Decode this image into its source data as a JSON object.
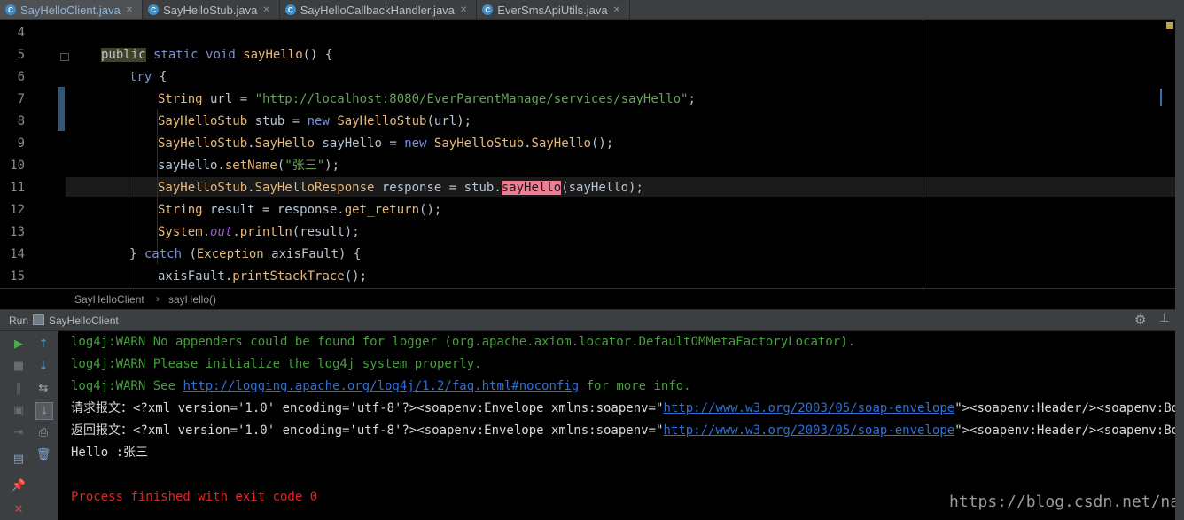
{
  "tabs": [
    {
      "label": "SayHelloClient.java",
      "icon": "C",
      "active": true
    },
    {
      "label": "SayHelloStub.java",
      "icon": "C",
      "active": false
    },
    {
      "label": "SayHelloCallbackHandler.java",
      "icon": "C",
      "active": false
    },
    {
      "label": "EverSmsApiUtils.java",
      "icon": "C",
      "active": false
    }
  ],
  "tab_close": "✕",
  "editor": {
    "line_numbers": [
      "4",
      "5",
      "6",
      "7",
      "8",
      "9",
      "10",
      "11",
      "12",
      "13",
      "14",
      "15"
    ],
    "lines": [
      {
        "indent": 0,
        "segments": []
      },
      {
        "indent": 1,
        "segments": [
          [
            "pub",
            "public"
          ],
          [
            "p",
            " "
          ],
          [
            "kw",
            "static"
          ],
          [
            "p",
            " "
          ],
          [
            "kw",
            "void"
          ],
          [
            "p",
            " "
          ],
          [
            "mth",
            "sayHello"
          ],
          [
            "p",
            "() {"
          ]
        ]
      },
      {
        "indent": 2,
        "segments": [
          [
            "kw",
            "try"
          ],
          [
            "p",
            " {"
          ]
        ]
      },
      {
        "indent": 3,
        "segments": [
          [
            "type",
            "String"
          ],
          [
            "p",
            " url = "
          ],
          [
            "str",
            "\"http://localhost:8080/EverParentManage/services/sayHello\""
          ],
          [
            "p",
            ";"
          ]
        ]
      },
      {
        "indent": 3,
        "segments": [
          [
            "type",
            "SayHelloStub"
          ],
          [
            "p",
            " stub = "
          ],
          [
            "kw",
            "new"
          ],
          [
            "p",
            " "
          ],
          [
            "type",
            "SayHelloStub"
          ],
          [
            "p",
            "(url);"
          ]
        ]
      },
      {
        "indent": 3,
        "segments": [
          [
            "type",
            "SayHelloStub"
          ],
          [
            "p",
            "."
          ],
          [
            "type",
            "SayHello"
          ],
          [
            "p",
            " sayHello = "
          ],
          [
            "kw",
            "new"
          ],
          [
            "p",
            " "
          ],
          [
            "type",
            "SayHelloStub"
          ],
          [
            "p",
            "."
          ],
          [
            "type",
            "SayHello"
          ],
          [
            "p",
            "();"
          ]
        ]
      },
      {
        "indent": 3,
        "segments": [
          [
            "p",
            "sayHello."
          ],
          [
            "mth",
            "setName"
          ],
          [
            "p",
            "("
          ],
          [
            "str",
            "\"张三\""
          ],
          [
            "p",
            ");"
          ]
        ]
      },
      {
        "indent": 3,
        "segments": [
          [
            "type",
            "SayHelloStub"
          ],
          [
            "p",
            "."
          ],
          [
            "type",
            "SayHelloResponse"
          ],
          [
            "p",
            " response = stub."
          ],
          [
            "hlm",
            "sayHello"
          ],
          [
            "p",
            "(sayHello);"
          ]
        ]
      },
      {
        "indent": 3,
        "segments": [
          [
            "type",
            "String"
          ],
          [
            "p",
            " result = response."
          ],
          [
            "mth",
            "get_return"
          ],
          [
            "p",
            "();"
          ]
        ]
      },
      {
        "indent": 3,
        "segments": [
          [
            "type",
            "System"
          ],
          [
            "p",
            "."
          ],
          [
            "fld",
            "out"
          ],
          [
            "p",
            "."
          ],
          [
            "mth",
            "println"
          ],
          [
            "p",
            "(result);"
          ]
        ]
      },
      {
        "indent": 2,
        "segments": [
          [
            "p",
            "} "
          ],
          [
            "kw",
            "catch"
          ],
          [
            "p",
            " ("
          ],
          [
            "type",
            "Exception"
          ],
          [
            "p",
            " axisFault) {"
          ]
        ]
      },
      {
        "indent": 3,
        "segments": [
          [
            "p",
            "axisFault."
          ],
          [
            "mth",
            "printStackTrace"
          ],
          [
            "p",
            "();"
          ]
        ]
      }
    ]
  },
  "breadcrumb": {
    "class_name": "SayHelloClient",
    "separator": "›",
    "method_name": "sayHello()"
  },
  "run_panel": {
    "title": "Run",
    "config_name": "SayHelloClient",
    "gear_icon": "⚙",
    "minimize_icon": "⊥"
  },
  "console": {
    "lines": [
      {
        "type": "warn",
        "segments": [
          [
            "t",
            "log4j:WARN No appenders could be found for logger (org.apache.axiom.locator.DefaultOMMetaFactoryLocator)."
          ]
        ]
      },
      {
        "type": "warn",
        "segments": [
          [
            "t",
            "log4j:WARN Please initialize the log4j system properly."
          ]
        ]
      },
      {
        "type": "warn",
        "segments": [
          [
            "t",
            "log4j:WARN See "
          ],
          [
            "l",
            "http://logging.apache.org/log4j/1.2/faq.html#noconfig"
          ],
          [
            "t",
            " for more info."
          ]
        ]
      },
      {
        "type": "out",
        "segments": [
          [
            "t",
            "请求报文：<?xml version='1.0' encoding='utf-8'?><soapenv:Envelope xmlns:soapenv=\""
          ],
          [
            "l",
            "http://www.w3.org/2003/05/soap-envelope"
          ],
          [
            "t",
            "\"><soapenv:Header/><soapenv:Body><ns"
          ]
        ]
      },
      {
        "type": "out",
        "segments": [
          [
            "t",
            "返回报文：<?xml version='1.0' encoding='utf-8'?><soapenv:Envelope xmlns:soapenv=\""
          ],
          [
            "l",
            "http://www.w3.org/2003/05/soap-envelope"
          ],
          [
            "t",
            "\"><soapenv:Header/><soapenv:Body><ns"
          ]
        ]
      },
      {
        "type": "out",
        "segments": [
          [
            "t",
            "Hello :张三"
          ]
        ]
      },
      {
        "type": "out",
        "segments": []
      },
      {
        "type": "err",
        "segments": [
          [
            "t",
            "Process finished with exit code 0"
          ]
        ]
      }
    ]
  },
  "toolbar_icons": [
    {
      "name": "rerun-icon",
      "glyph": "▶",
      "color": "#4cad4c",
      "interactable": true
    },
    {
      "name": "up-arrow-icon",
      "glyph": "↑",
      "color": "#4aa3df",
      "interactable": true
    },
    {
      "name": "stop-icon",
      "glyph": "■",
      "color": "#6a6a6a",
      "interactable": true
    },
    {
      "name": "down-arrow-icon",
      "glyph": "↓",
      "color": "#4aa3df",
      "interactable": true
    },
    {
      "name": "pause-icon",
      "glyph": "‖",
      "color": "#6a6a6a",
      "interactable": true
    },
    {
      "name": "soft-wrap-icon",
      "glyph": "⇆",
      "color": "#9aa5b5",
      "interactable": true
    },
    {
      "name": "dump-threads-icon",
      "glyph": "▣",
      "color": "#6a6a6a",
      "interactable": true
    },
    {
      "name": "scroll-to-end-icon",
      "glyph": "⤓",
      "color": "#9aa5b5",
      "interactable": true
    },
    {
      "name": "exit-icon",
      "glyph": "⇥",
      "color": "#6a6a6a",
      "interactable": true
    },
    {
      "name": "print-icon",
      "glyph": "⎙",
      "color": "#9aa5b5",
      "interactable": true
    },
    {
      "name": "layout-icon",
      "glyph": "▤",
      "color": "#7fa3cc",
      "interactable": true
    },
    {
      "name": "trash-icon",
      "glyph": "🗑",
      "color": "#7fa3cc",
      "interactable": true
    },
    {
      "name": "pin-icon",
      "glyph": "📌",
      "color": "#a07cc0",
      "interactable": true
    },
    {
      "name": "close-icon",
      "glyph": "✕",
      "color": "#d94545",
      "interactable": true
    }
  ],
  "watermark": "https://blog.csdn.net/nanshaowei"
}
